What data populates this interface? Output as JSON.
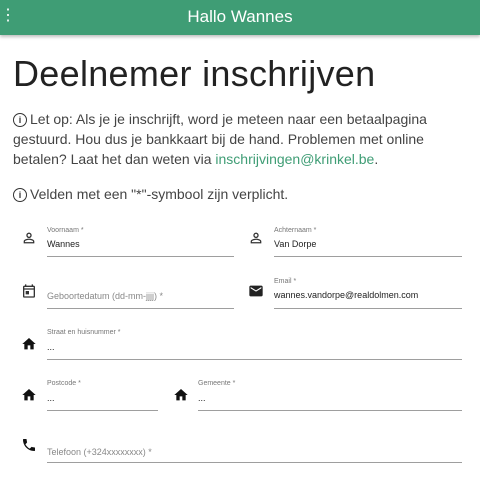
{
  "appbar": {
    "title": "Hallo Wannes",
    "menu_glyph": "⋮"
  },
  "page_title": "Deelnemer inschrijven",
  "notice": {
    "text": "Let op: Als je je inschrijft, word je meteen naar een betaalpagina gestuurd. Hou dus je bankkaart bij de hand. Problemen met online betalen? Laat het dan weten via ",
    "email": "inschrijvingen@krinkel.be",
    "end": "."
  },
  "required_note": "Velden met een \"*\"-symbool zijn verplicht.",
  "info_glyph": "i",
  "form": {
    "voornaam": {
      "label": "Voornaam *",
      "value": "Wannes"
    },
    "achternaam": {
      "label": "Achternaam *",
      "value": "Van Dorpe"
    },
    "geboortedatum": {
      "placeholder": "Geboortedatum (dd-mm-jjjj) *"
    },
    "email": {
      "label": "Email *",
      "value": "wannes.vandorpe@realdolmen.com"
    },
    "straat": {
      "label": "Straat en huisnummer *",
      "value": "..."
    },
    "postcode": {
      "label": "Postcode *",
      "value": "..."
    },
    "gemeente": {
      "label": "Gemeente *",
      "value": "..."
    },
    "telefoon": {
      "placeholder": "Telefoon (+324xxxxxxxx) *"
    }
  },
  "colors": {
    "appbar": "#3f9d75",
    "link": "#3f9d75"
  },
  "icons": [
    "menu-icon",
    "info-icon",
    "person-icon",
    "calendar-icon",
    "mail-icon",
    "home-icon",
    "phone-icon"
  ]
}
